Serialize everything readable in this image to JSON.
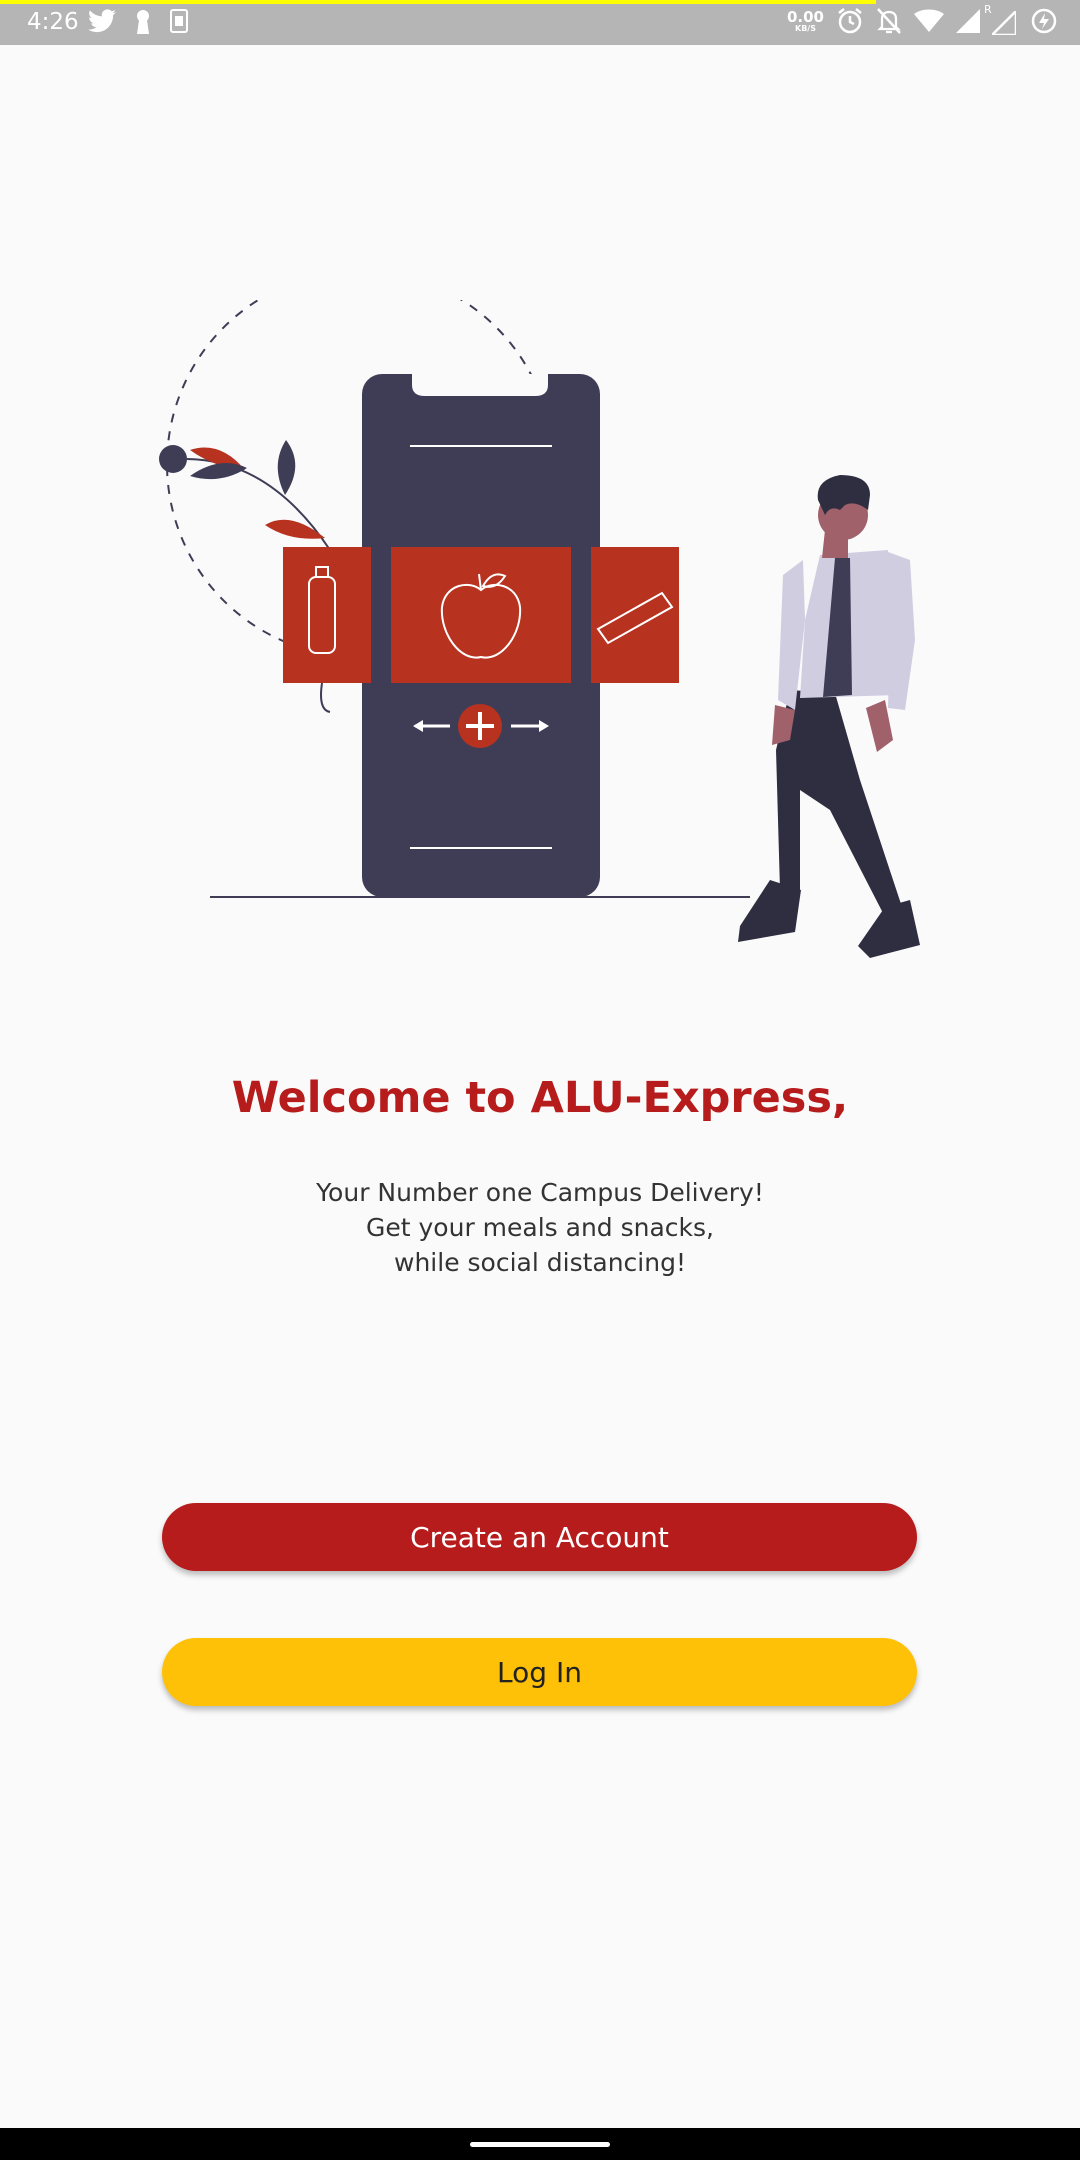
{
  "status_bar": {
    "time": "4:26",
    "net_speed_value": "0.00",
    "net_speed_unit": "KB/S",
    "left_icons": [
      "twitter-icon",
      "keyhole-icon",
      "sim-card-icon"
    ],
    "right_icons": [
      "alarm-icon",
      "mute-notifications-icon",
      "wifi-icon",
      "signal-icon",
      "signal-roaming-icon",
      "battery-charging-icon"
    ],
    "roaming_label": "R"
  },
  "welcome": {
    "title": "Welcome to ALU-Express,",
    "lines": [
      "Your Number one Campus Delivery!",
      "Get your meals and snacks,",
      "while social distancing!"
    ]
  },
  "buttons": {
    "create_account": "Create an Account",
    "log_in": "Log In"
  },
  "colors": {
    "primary": "#b71c1c",
    "accent": "#ffc107",
    "illustration_red": "#b83220",
    "phone_dark": "#3f3d56"
  }
}
